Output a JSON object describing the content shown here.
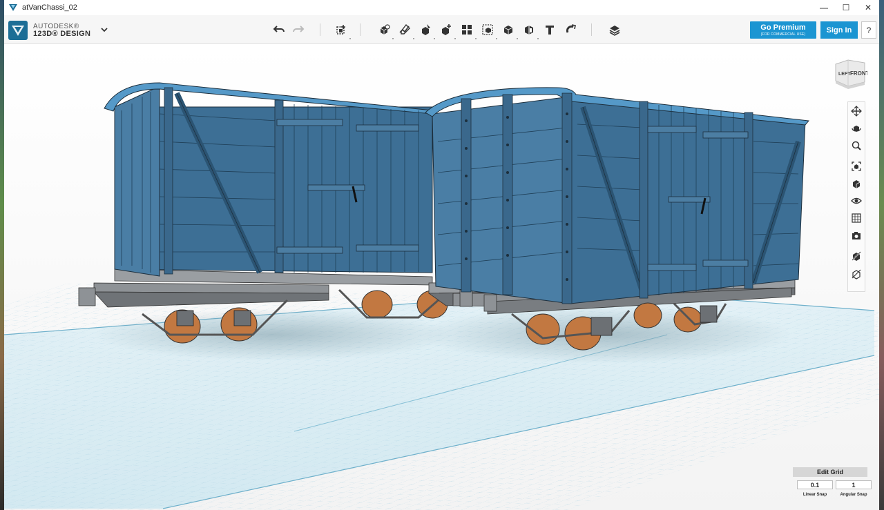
{
  "window": {
    "title": "atVanChassi_02",
    "minimize_glyph": "—",
    "maximize_glyph": "☐",
    "close_glyph": "✕"
  },
  "logo": {
    "brand": "AUTODESK®",
    "product": "123D® DESIGN"
  },
  "toolbar": {
    "icons": [
      "undo-icon",
      "redo-icon",
      "transform-icon",
      "primitives-icon",
      "sketch-icon",
      "construct-icon",
      "modify-icon",
      "pattern-icon",
      "grouping-icon",
      "combine-icon",
      "measure-icon",
      "text-icon",
      "snap-icon",
      "material-icon"
    ]
  },
  "account": {
    "premium_label": "Go Premium",
    "premium_sub": "(FOR COMMERCIAL USE)",
    "signin_label": "Sign In",
    "help_label": "?"
  },
  "viewcube": {
    "left_label": "LEFT",
    "front_label": "FRONT"
  },
  "navbar": {
    "icons": [
      "pan-icon",
      "orbit-icon",
      "zoom-icon",
      "fit-icon",
      "view-mode-icon",
      "visibility-icon",
      "material-render-icon",
      "camera-icon",
      "hide-icon",
      "show-all-icon"
    ]
  },
  "grid": {
    "edit_label": "Edit Grid",
    "linear_value": "0.1",
    "angular_value": "1",
    "linear_label": "Linear Snap",
    "angular_label": "Angular Snap"
  },
  "colors": {
    "accent": "#1b95d2",
    "wagon_body": "#3d6f95",
    "wagon_roof": "#5599c8",
    "wheel": "#c27841",
    "chassis": "#8e9296",
    "grid_fill": "#d8ebf2",
    "grid_line": "#7fb9d2"
  }
}
